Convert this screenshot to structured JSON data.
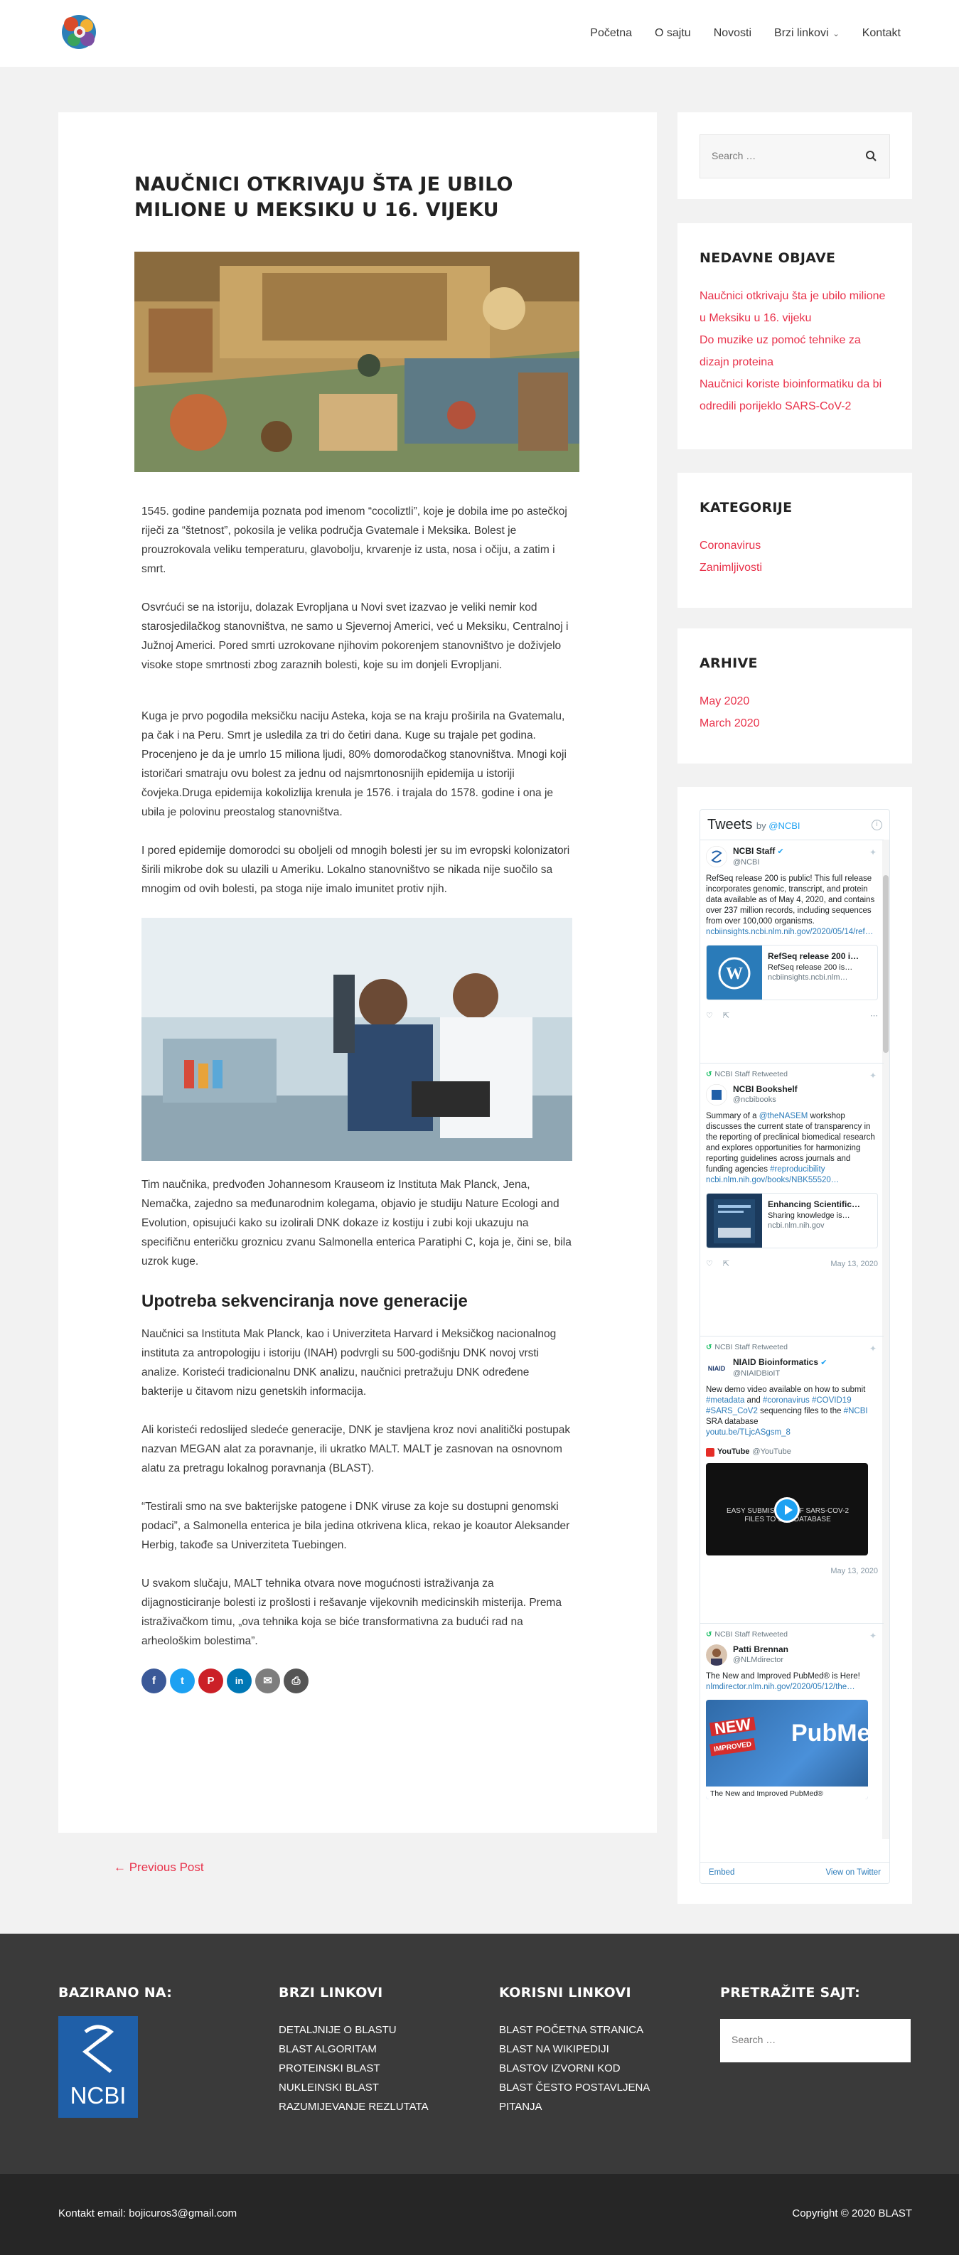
{
  "nav": {
    "items": [
      "Početna",
      "O sajtu",
      "Novosti",
      "Brzi linkovi",
      "Kontakt"
    ]
  },
  "post": {
    "title": "NAUČNICI OTKRIVAJU ŠTA JE UBILO MILIONE U MEKSIKU U 16. VIJEKU",
    "p1": "1545. godine pandemija poznata pod imenom “cocoliztli”, koje je dobila ime po astečkoj riječi za “štetnost”, pokosila je velika područja Gvatemale i Meksika. Bolest je prouzrokovala veliku temperaturu, glavobolju, krvarenje iz usta, nosa i očiju, a zatim i smrt.",
    "p2": "Osvrćući se na istoriju, dolazak Evropljana u Novi svet izazvao je veliki nemir kod starosjedilačkog stanovništva, ne samo u Sjevernoj Americi, već u Meksiku, Centralnoj i Južnoj Americi. Pored smrti uzrokovane njihovim pokorenjem stanovništvo je doživjelo visoke stope smrtnosti zbog zaraznih bolesti, koje su im donjeli Evropljani.",
    "p3": "Kuga je prvo pogodila meksičku naciju Asteka, koja se na kraju proširila na Gvatemalu, pa čak i na Peru. Smrt je usledila za tri do četiri dana. Kuge su trajale pet godina. Procenjeno je da je umrlo 15 miliona ljudi, 80% domorodačkog stanovništva. Mnogi koji istoričari smatraju ovu bolest za jednu od najsmrtonosnijih epidemija u istoriji čovjeka.Druga epidemija kokolizlija krenula je 1576. i trajala do 1578. godine i ona je ubila je polovinu preostalog stanovništva.",
    "p4": " I pored epidemije domorodci su oboljeli od mnogih bolesti jer su im evropski kolonizatori širili mikrobe dok su ulazili u Ameriku. Lokalno stanovništvo se nikada nije suočilo sa mnogim od ovih bolesti, pa stoga nije imalo imunitet protiv njih.",
    "p5": "Tim naučnika, predvođen Johannesom Krauseom iz Instituta Mak Planck, Jena, Nemačka, zajedno sa međunarodnim kolegama, objavio je studiju Nature Ecologi and Evolution, opisujući kako su izolirali DNK dokaze iz kostiju i zubi koji ukazuju na specifičnu enteričku groznicu zvanu Salmonella enterica Paratiphi C, koja je, čini se, bila uzrok kuge.",
    "h2": "Upotreba sekvenciranja nove generacije",
    "p6": "Naučnici sa Instituta Mak Planck, kao i Univerziteta Harvard i Meksičkog nacionalnog instituta za antropologiju i istoriju (INAH) podvrgli su 500-godišnju DNK novoj vrsti analize. Koristeći tradicionalnu DNK analizu, naučnici pretražuju DNK određene bakterije u čitavom nizu genetskih informacija.",
    "p7": "Ali koristeći redoslijed sledeće generacije, DNK je stavljena kroz novi analitički postupak nazvan MEGAN alat za poravnanje, ili ukratko MALT. MALT je zasnovan na osnovnom alatu za pretragu lokalnog poravnanja (BLAST).",
    "p8": "“Testirali smo na sve bakterijske patogene i DNK viruse za koje su dostupni genomski podaci”, a Salmonella enterica je bila jedina otkrivena klica, rekao je koautor Aleksander Herbig, takođe sa Univerziteta Tuebingen.",
    "p9": "U svakom slučaju, MALT tehnika otvara nove mogućnosti istraživanja za dijagnosticiranje bolesti iz prošlosti i rešavanje vijekovnih medicinskih misterija. Prema istraživačkom timu, „ova tehnika koja se biće transformativna za budući rad na arheološkim bolestima”.",
    "prev": "← Previous Post"
  },
  "sidebar": {
    "search_placeholder": "Search …",
    "recent_title": "NEDAVNE OBJAVE",
    "recent": [
      "Naučnici otkrivaju šta je ubilo milione u Meksiku u 16. vijeku",
      "Do muzike uz pomoć tehnike za dizajn proteina",
      "Naučnici koriste bioinformatiku da bi odredili porijeklo SARS-CoV-2"
    ],
    "cats_title": "KATEGORIJE",
    "cats": [
      "Coronavirus",
      "Zanimljivosti"
    ],
    "arch_title": "ARHIVE",
    "arch": [
      "May 2020",
      "March 2020"
    ]
  },
  "twitter": {
    "title": "Tweets",
    "by": "by",
    "by_handle": "@NCBI",
    "t1_name": "NCBI Staff",
    "t1_handle": "@NCBI",
    "t1_text": "RefSeq release 200 is public! This full release incorporates genomic, transcript, and protein data available as of May 4, 2020, and contains over 237 million records, including sequences from over 100,000 organisms.",
    "t1_link": "ncbiinsights.ncbi.nlm.nih.gov/2020/05/14/ref…",
    "t1_card_title": "RefSeq release 200 i…",
    "t1_card_text": "RefSeq release 200 is…",
    "t1_card_domain": "ncbiinsights.ncbi.nlm…",
    "rt_label": "NCBI Staff Retweeted",
    "t2_name": "NCBI Bookshelf",
    "t2_handle": "@ncbibooks",
    "t2_text_a": "Summary of a ",
    "t2_mention": "@theNASEM",
    "t2_text_b": " workshop discusses the current state of transparency in the reporting of preclinical biomedical research and explores opportunities for harmonizing reporting guidelines across journals and funding agencies ",
    "t2_tag": "#reproducibility",
    "t2_link": "ncbi.nlm.nih.gov/books/NBK55520…",
    "t2_card_title": "Enhancing Scientific…",
    "t2_card_text": "Sharing knowledge is…",
    "t2_card_domain": "ncbi.nlm.nih.gov",
    "t2_date": "May 13, 2020",
    "t3_name": "NIAID Bioinformatics",
    "t3_handle": "@NIAIDBioIT",
    "t3_text_a": "New demo video available on how to submit ",
    "t3_tag1": "#metadata",
    "t3_text_b": " and ",
    "t3_tag2": "#coronavirus",
    "t3_tag3": "#COVID19",
    "t3_tag4": "#SARS_CoV2",
    "t3_text_c": " sequencing files to the ",
    "t3_tag5": "#NCBI",
    "t3_text_d": " SRA database ",
    "t3_link": "youtu.be/TLjcASgsm_8",
    "yt_name": "YouTube",
    "yt_handle": "@YouTube",
    "video_text": "EASY SUBMISSION OF SARS-COV-2 FILES TO SRA DATABASE",
    "t3_date": "May 13, 2020",
    "t4_name": "Patti Brennan",
    "t4_handle": "@NLMdirector",
    "t4_text": "The New and Improved PubMed® is Here! ",
    "t4_link": "nlmdirector.nlm.nih.gov/2020/05/12/the…",
    "t4_img_new": "NEW",
    "t4_img_improved": "IMPROVED",
    "t4_img_pub": "PubMed",
    "t4_caption": "The New and Improved PubMed®",
    "embed": "Embed",
    "view": "View on Twitter"
  },
  "footer": {
    "col1_title": "BAZIRANO NA:",
    "ncbi_label": "NCBI",
    "col2_title": "BRZI LINKOVI",
    "col2": [
      "DETALJNIJE O BLASTU",
      "BLAST ALGORITAM",
      "PROTEINSKI BLAST",
      "NUKLEINSKI BLAST",
      "RAZUMIJEVANJE REZLUTATA"
    ],
    "col3_title": "KORISNI LINKOVI",
    "col3": [
      "BLAST POČETNA STRANICA",
      "BLAST NA WIKIPEDIJI",
      "BLASTOV IZVORNI KOD",
      "BLAST ČESTO POSTAVLJENA PITANJA"
    ],
    "col4_title": "PRETRAŽITE SAJT:",
    "search_placeholder": "Search …",
    "contact": "Kontakt email: bojicuros3@gmail.com",
    "copyright": "Copyright © 2020 BLAST"
  },
  "colors": {
    "accent": "#e8314a",
    "footer_dark": "#3a3a3a",
    "footer_darker": "#262626",
    "twitter_blue": "#1da1f2"
  }
}
